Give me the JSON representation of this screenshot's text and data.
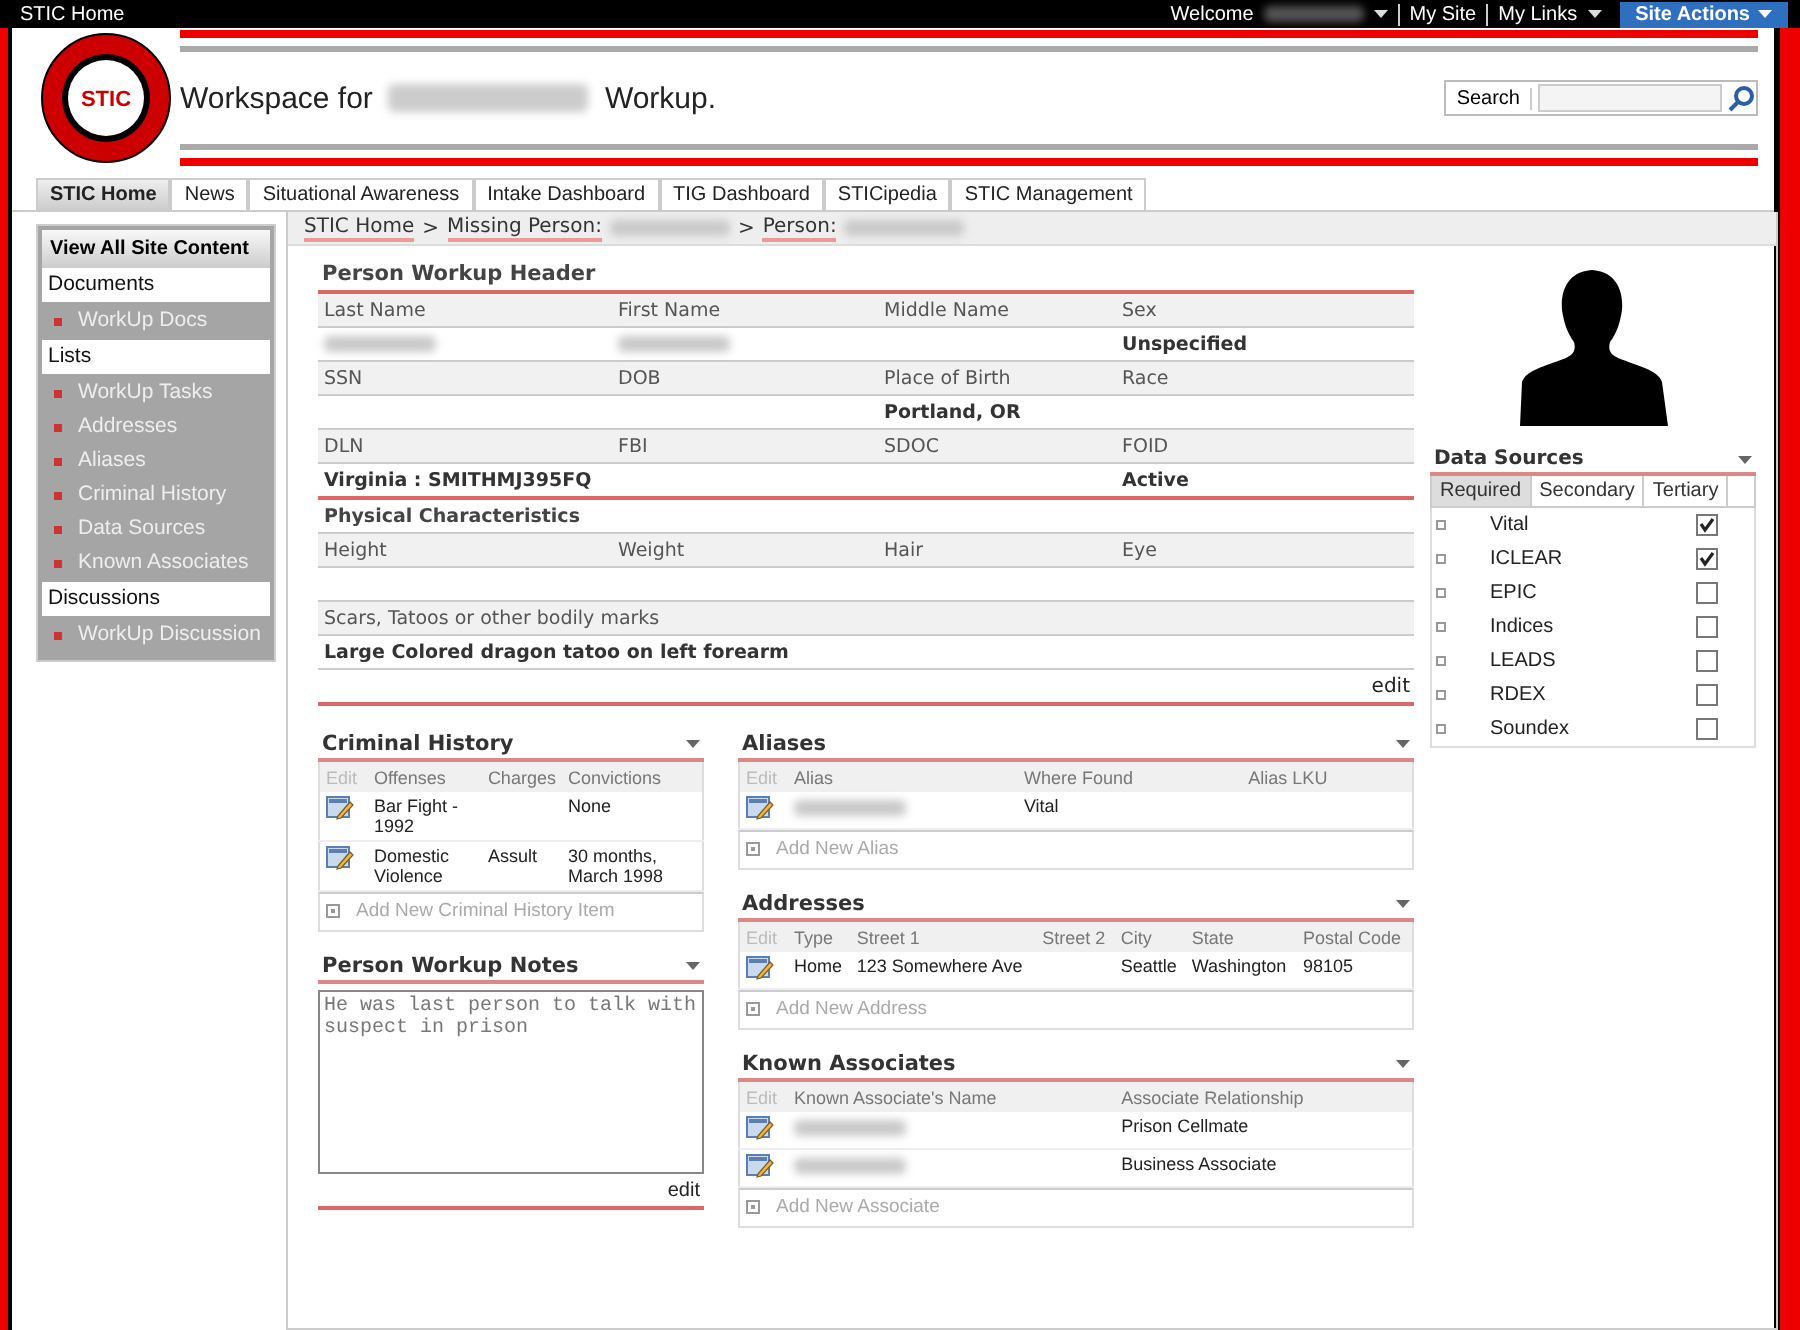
{
  "top_bar": {
    "site": "STIC Home",
    "welcome": "Welcome",
    "links": [
      "My Site",
      "My Links"
    ],
    "site_actions": "Site Actions"
  },
  "header": {
    "logo_text": "STIC",
    "title_before": "Workspace for",
    "title_after": "Workup.",
    "search_label": "Search"
  },
  "tabs": [
    {
      "label": "STIC Home",
      "selected": true
    },
    {
      "label": "News",
      "selected": false
    },
    {
      "label": "Situational Awareness",
      "selected": false
    },
    {
      "label": "Intake Dashboard",
      "selected": false
    },
    {
      "label": "TIG Dashboard",
      "selected": false
    },
    {
      "label": "STICipedia",
      "selected": false
    },
    {
      "label": "STIC Management",
      "selected": false
    }
  ],
  "sidebar": {
    "view_all": "View All Site Content",
    "sections": [
      {
        "title": "Documents",
        "items": [
          "WorkUp Docs"
        ]
      },
      {
        "title": "Lists",
        "items": [
          "WorkUp Tasks",
          "Addresses",
          "Aliases",
          "Criminal History",
          "Data Sources",
          "Known Associates"
        ]
      },
      {
        "title": "Discussions",
        "items": [
          "WorkUp Discussion"
        ]
      }
    ]
  },
  "breadcrumb": [
    {
      "kind": "link",
      "text": "STIC Home"
    },
    {
      "kind": "separator",
      "text": ">"
    },
    {
      "kind": "link",
      "text": "Missing Person:"
    },
    {
      "kind": "redacted"
    },
    {
      "kind": "separator",
      "text": ">"
    },
    {
      "kind": "link",
      "text": "Person:"
    },
    {
      "kind": "redacted"
    }
  ],
  "workup_header": {
    "title": "Person Workup Header",
    "edit": "edit",
    "rows": [
      {
        "kind": "labels",
        "cells": [
          "Last Name",
          "First Name",
          "Middle Name",
          "Sex"
        ]
      },
      {
        "kind": "values",
        "cells": [
          {
            "kind": "redacted"
          },
          {
            "kind": "redacted"
          },
          {
            "kind": "empty"
          },
          {
            "kind": "text",
            "text": "Unspecified"
          }
        ]
      },
      {
        "kind": "labels",
        "cells": [
          "SSN",
          "DOB",
          "Place of Birth",
          "Race"
        ]
      },
      {
        "kind": "values",
        "cells": [
          {
            "kind": "empty"
          },
          {
            "kind": "empty"
          },
          {
            "kind": "text",
            "text": "Portland, OR"
          },
          {
            "kind": "empty"
          }
        ]
      },
      {
        "kind": "labels",
        "cells": [
          "DLN",
          "FBI",
          "SDOC",
          "FOID"
        ]
      },
      {
        "kind": "values",
        "cells": [
          {
            "kind": "text",
            "text": "Virginia  : SMITHMJ395FQ"
          },
          {
            "kind": "empty"
          },
          {
            "kind": "empty"
          },
          {
            "kind": "text",
            "text": "Active"
          }
        ]
      },
      {
        "kind": "heading",
        "text": "Physical Characteristics"
      },
      {
        "kind": "labels",
        "cells": [
          "Height",
          "Weight",
          "Hair",
          "Eye"
        ]
      },
      {
        "kind": "values",
        "cells": [
          {
            "kind": "empty"
          },
          {
            "kind": "empty"
          },
          {
            "kind": "empty"
          },
          {
            "kind": "empty"
          }
        ]
      },
      {
        "kind": "wide_label",
        "text": "Scars, Tatoos or other bodily marks"
      },
      {
        "kind": "wide_value",
        "text": "Large Colored dragon tatoo on left forearm"
      }
    ]
  },
  "data_sources": {
    "title": "Data Sources",
    "tabs": [
      {
        "label": "Required",
        "selected": true
      },
      {
        "label": "Secondary",
        "selected": false
      },
      {
        "label": "Tertiary",
        "selected": false
      }
    ],
    "items": [
      {
        "label": "Vital",
        "checked": true
      },
      {
        "label": "ICLEAR",
        "checked": true
      },
      {
        "label": "EPIC",
        "checked": false
      },
      {
        "label": "Indices",
        "checked": false
      },
      {
        "label": "LEADS",
        "checked": false
      },
      {
        "label": "RDEX",
        "checked": false
      },
      {
        "label": "Soundex",
        "checked": false
      }
    ]
  },
  "criminal_history": {
    "title": "Criminal History",
    "columns": [
      "Edit",
      "Offenses",
      "Charges",
      "Convictions"
    ],
    "rows": [
      {
        "cells": [
          {
            "kind": "edit"
          },
          {
            "kind": "text",
            "text": "Bar Fight - 1992"
          },
          {
            "kind": "empty"
          },
          {
            "kind": "text",
            "text": "None"
          }
        ]
      },
      {
        "cells": [
          {
            "kind": "edit"
          },
          {
            "kind": "text",
            "text": "Domestic Violence"
          },
          {
            "kind": "text",
            "text": "Assult"
          },
          {
            "kind": "text",
            "text": "30 months, March 1998"
          }
        ]
      }
    ],
    "add": "Add New Criminal History Item"
  },
  "notes": {
    "title": "Person Workup Notes",
    "value": "He was last person to talk with suspect in prison",
    "edit": "edit"
  },
  "aliases": {
    "title": "Aliases",
    "columns": [
      "Edit",
      "Alias",
      "Where Found",
      "Alias LKU"
    ],
    "rows": [
      {
        "cells": [
          {
            "kind": "edit"
          },
          {
            "kind": "redacted"
          },
          {
            "kind": "text",
            "text": "Vital"
          },
          {
            "kind": "empty"
          }
        ]
      }
    ],
    "add": "Add New Alias"
  },
  "addresses": {
    "title": "Addresses",
    "columns": [
      "Edit",
      "Type",
      "Street 1",
      "Street 2",
      "City",
      "State",
      "Postal Code"
    ],
    "rows": [
      {
        "cells": [
          {
            "kind": "edit"
          },
          {
            "kind": "text",
            "text": "Home"
          },
          {
            "kind": "text",
            "text": "123 Somewhere Ave"
          },
          {
            "kind": "empty"
          },
          {
            "kind": "text",
            "text": "Seattle"
          },
          {
            "kind": "text",
            "text": "Washington"
          },
          {
            "kind": "text",
            "text": "98105"
          }
        ]
      }
    ],
    "add": "Add New Address"
  },
  "known_associates": {
    "title": "Known Associates",
    "columns": [
      "Edit",
      "Known Associate's Name",
      "Associate Relationship"
    ],
    "rows": [
      {
        "cells": [
          {
            "kind": "edit"
          },
          {
            "kind": "redacted"
          },
          {
            "kind": "text",
            "text": "Prison Cellmate"
          }
        ]
      },
      {
        "cells": [
          {
            "kind": "edit"
          },
          {
            "kind": "redacted"
          },
          {
            "kind": "text",
            "text": "Business Associate"
          }
        ]
      }
    ],
    "add": "Add New Associate"
  }
}
